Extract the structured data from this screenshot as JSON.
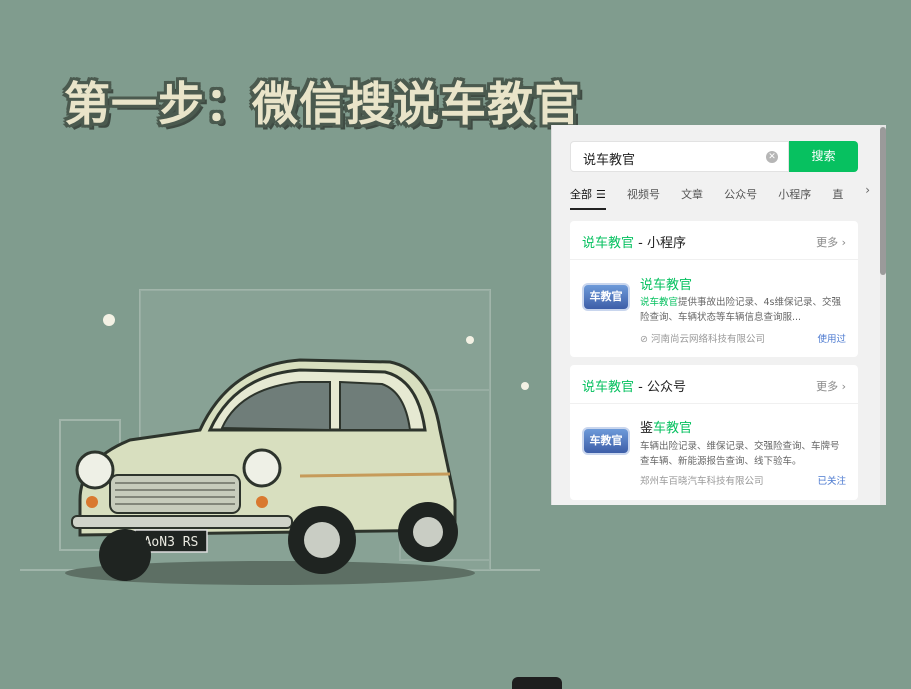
{
  "headline": "第一步：微信搜说车教官",
  "search": {
    "query": "说车教官",
    "button_label": "搜索",
    "clear_icon": "clear-icon"
  },
  "tabs": {
    "items": [
      "全部",
      "视频号",
      "文章",
      "公众号",
      "小程序",
      "直"
    ],
    "active": "全部"
  },
  "mini_program_card": {
    "title_keyword": "说车教官",
    "title_suffix": " - 小程序",
    "more_label": "更多 ›",
    "item": {
      "logo_text": "车教官",
      "name": "说车教官",
      "desc_keyword": "说车教官",
      "desc_rest": "提供事故出险记录、4s维保记录、交强险查询、车辆状态等车辆信息查询服...",
      "company": "⊘ 河南尚云网络科技有限公司",
      "status": "使用过"
    }
  },
  "official_account_card": {
    "title_keyword": "说车教官",
    "title_suffix": " - 公众号",
    "more_label": "更多 ›",
    "item": {
      "logo_text": "车教官",
      "name_prefix": "鉴",
      "name_keyword": "车教官",
      "desc": "车辆出险记录、维保记录、交强险查询、车牌号查车辆、新能源报告查询、线下验车。",
      "company": "郑州车百晓汽车科技有限公司",
      "status": "已关注"
    }
  },
  "car_plate": "AoN3 RS",
  "colors": {
    "background": "#809c8e",
    "accent_green": "#07c160",
    "link_blue": "#4c7ad0"
  }
}
